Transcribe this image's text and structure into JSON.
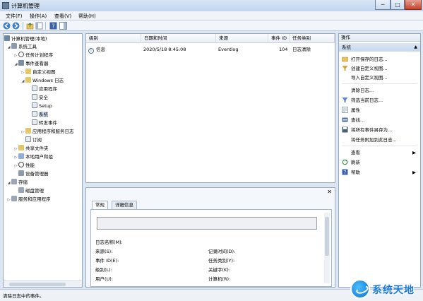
{
  "window": {
    "title": "计算机管理",
    "min": "─",
    "max": "□",
    "close": "✕"
  },
  "menu": [
    "文件(F)",
    "操作(A)",
    "查看(V)",
    "帮助(H)"
  ],
  "tree": [
    {
      "label": "计算机管理(本地)"
    },
    {
      "label": "系统工具"
    },
    {
      "label": "任务计划程序"
    },
    {
      "label": "事件查看器"
    },
    {
      "label": "自定义视图"
    },
    {
      "label": "Windows 日志"
    },
    {
      "label": "应用程序"
    },
    {
      "label": "安全"
    },
    {
      "label": "Setup"
    },
    {
      "label": "系统"
    },
    {
      "label": "转发事件"
    },
    {
      "label": "应用程序和服务日志"
    },
    {
      "label": "订阅"
    },
    {
      "label": "共享文件夹"
    },
    {
      "label": "本地用户和组"
    },
    {
      "label": "性能"
    },
    {
      "label": "设备管理器"
    },
    {
      "label": "存储"
    },
    {
      "label": "磁盘管理"
    },
    {
      "label": "服务和应用程序"
    }
  ],
  "events": {
    "columns": [
      "级别",
      "日期和时间",
      "来源",
      "事件 ID",
      "任务类别"
    ],
    "rows": [
      {
        "level": "信息",
        "datetime": "2020/5/18 8:45:08",
        "source": "Eventlog",
        "id": "104",
        "category": "日志清除"
      }
    ]
  },
  "detail": {
    "tabs": [
      "常规",
      "详细信息"
    ],
    "fields_left": [
      "日志名称(M):",
      "来源(S):",
      "事件 ID(E):",
      "级别(L):",
      "用户(U):"
    ],
    "fields_right": [
      "记录时间(D):",
      "任务类别(Y):",
      "关键字(K):",
      "计算机(R):"
    ]
  },
  "actions": {
    "header": "操作",
    "section": "系统",
    "items": [
      {
        "label": "打开保存的日志...",
        "icon": "folder-open-icon"
      },
      {
        "label": "创建自定义视图...",
        "icon": "filter-icon"
      },
      {
        "label": "导入自定义视图...",
        "icon": ""
      },
      {
        "label": "清除日志...",
        "icon": ""
      },
      {
        "label": "筛选当前日志...",
        "icon": "filter-icon"
      },
      {
        "label": "属性",
        "icon": "properties-icon"
      },
      {
        "label": "查找...",
        "icon": "find-icon"
      },
      {
        "label": "将所有事件另存为...",
        "icon": "save-icon"
      },
      {
        "label": "将任务附加到此日志...",
        "icon": ""
      },
      {
        "label": "查看",
        "icon": "",
        "submenu": true
      },
      {
        "label": "刷新",
        "icon": "refresh-icon"
      },
      {
        "label": "帮助",
        "icon": "help-icon",
        "submenu": true
      }
    ]
  },
  "status": "清除日志中的事件。",
  "watermark": "系统天地"
}
